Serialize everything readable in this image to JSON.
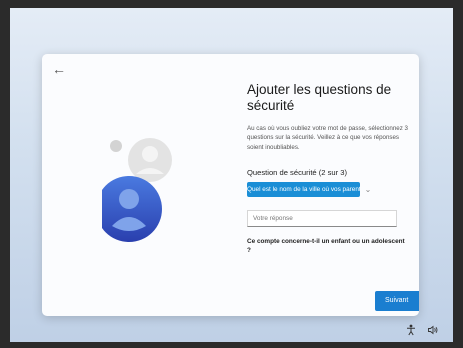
{
  "card": {
    "title": "Ajouter les questions de sécurité",
    "description": "Au cas où vous oubliez votre mot de passe, sélectionnez 3 questions sur la sécurité. Veillez à ce que vos réponses soient inoubliables.",
    "question_label": "Question de sécurité (2 sur 3)",
    "selected_question": "Quel est le nom de la ville où vos parent",
    "answer_placeholder": "Votre réponse",
    "child_question": "Ce compte concerne-t-il un enfant ou un adolescent ?",
    "next_label": "Suivant"
  },
  "colors": {
    "accent": "#1a8ed6",
    "button": "#1a7ed0",
    "avatar_front": "#3a55c8",
    "avatar_back": "#d9d9d9"
  },
  "icons": [
    "back-arrow-icon",
    "avatar-icon",
    "chevron-down-icon",
    "accessibility-icon",
    "volume-icon"
  ]
}
